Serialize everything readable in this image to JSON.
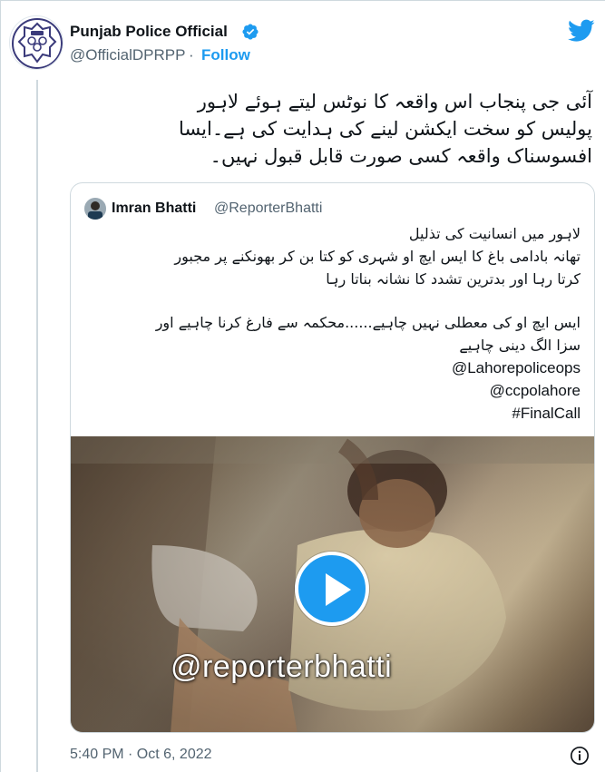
{
  "author": {
    "name": "Punjab Police Official",
    "handle": "@OfficialDPRPP",
    "separator": "·",
    "follow_label": "Follow",
    "verified": true
  },
  "tweet": {
    "text": "آئی جی پنجاب  اس واقعہ کا نوٹس لیتے ہوئے لاہور\nپولیس کو سخت ایکشن لینے کی ہدایت کی ہے۔ایسا\nافسوسناک واقعہ کسی صورت قابل قبول نہیں۔"
  },
  "quote": {
    "name": "Imran Bhatti",
    "handle": "@ReporterBhatti",
    "lines": [
      "لاہور میں انسانیت کی تذلیل",
      " تھانہ بادامی باغ کا ایس ایچ او شہری کو کتا بن کر بھونکنے پر مجبور",
      "کرتا رہا اور بدترین تشدد کا نشانہ بناتا رہا",
      "",
      "ایس ایچ او کی معطلی نہیں چاہیے......محکمہ سے فارغ کرنا چاہیے اور",
      "سزا الگ دینی چاہیے",
      "@Lahorepoliceops",
      "@ccpolahore",
      "#FinalCall"
    ],
    "video_watermark": "@reporterbhatti"
  },
  "timestamp": "5:40 PM · Oct 6, 2022",
  "colors": {
    "accent": "#1d9bf0",
    "text": "#0f1419",
    "muted": "#536471",
    "border": "#cfd9de"
  },
  "icons": [
    "police-logo-icon",
    "verified-badge-icon",
    "twitter-bird-icon",
    "play-icon",
    "info-icon"
  ]
}
